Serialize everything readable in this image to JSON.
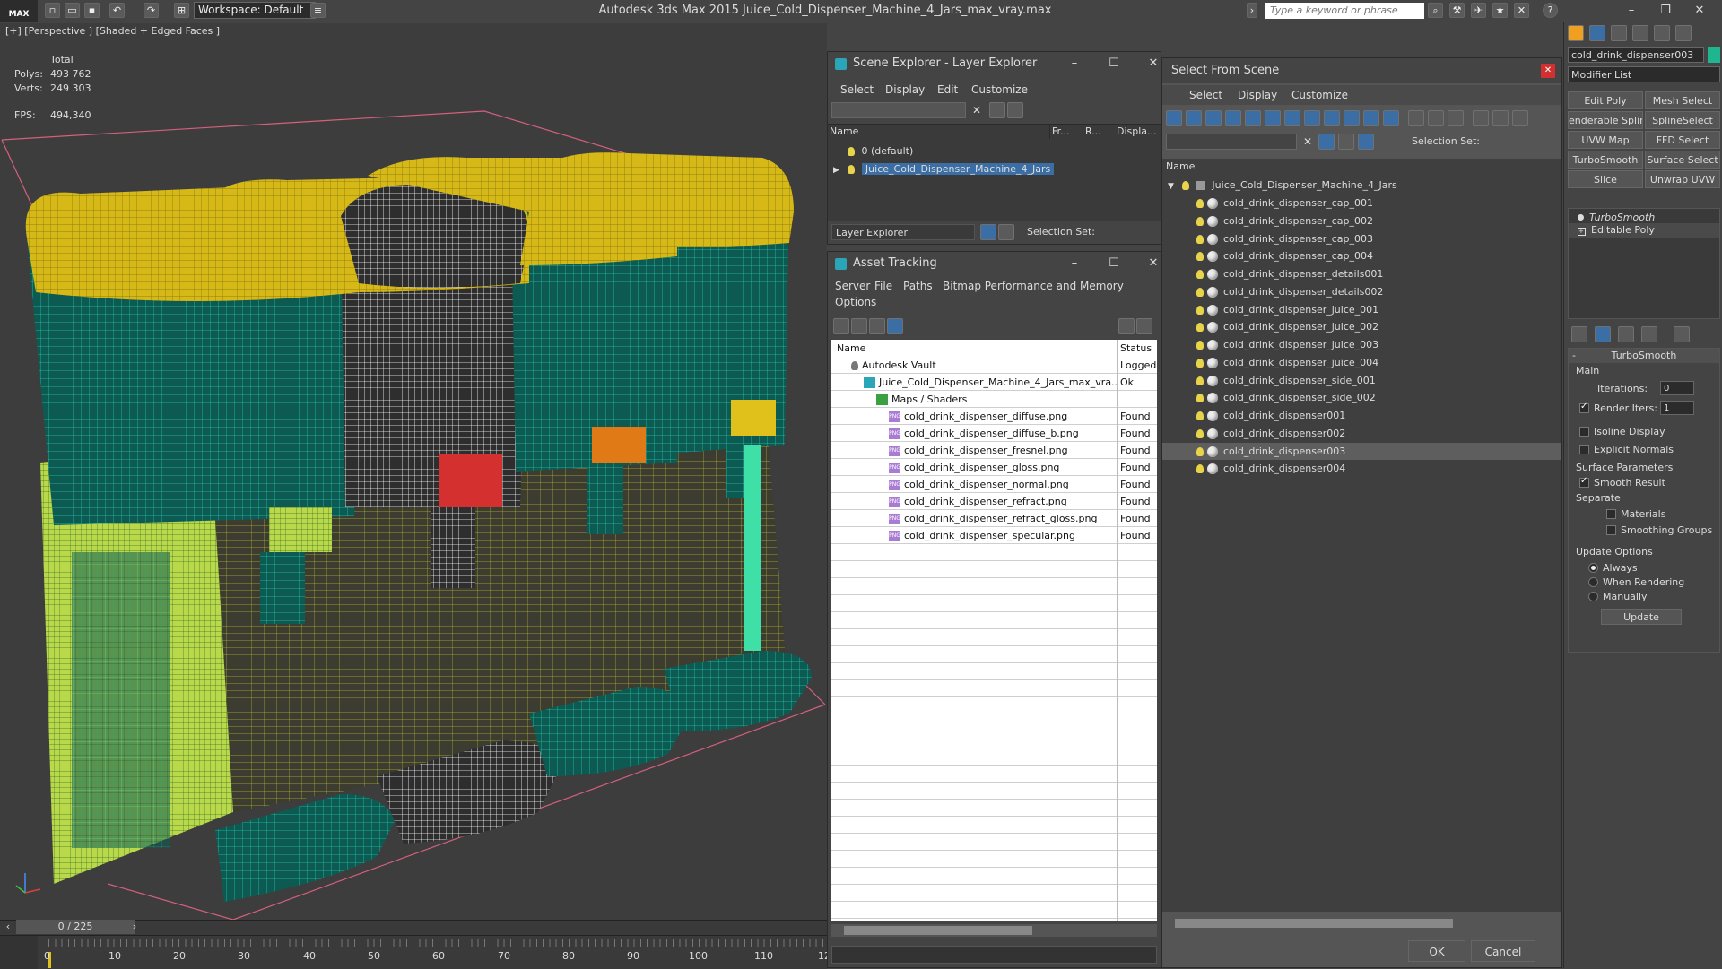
{
  "app": {
    "logo": "MAX",
    "workspace": "Workspace: Default",
    "window_title": "Autodesk 3ds Max  2015     Juice_Cold_Dispenser_Machine_4_Jars_max_vray.max",
    "search_placeholder": "Type a keyword or phrase",
    "controls": {
      "minimize": "–",
      "restore": "❐",
      "close": "✕"
    }
  },
  "viewport": {
    "label": "[+] [Perspective ] [Shaded + Edged Faces ]",
    "stats": {
      "total_label": "Total",
      "polys_label": "Polys:",
      "polys_value": "493 762",
      "verts_label": "Verts:",
      "verts_value": "249 303",
      "fps_label": "FPS:",
      "fps_value": "494,340"
    },
    "axis": {
      "x": "x",
      "y": "y",
      "z": "z"
    }
  },
  "timeline": {
    "frame_indicator": "0 / 225",
    "ticks": [
      "0",
      "10",
      "20",
      "30",
      "40",
      "50",
      "60",
      "70",
      "80",
      "90",
      "100",
      "110",
      "12"
    ]
  },
  "scene_explorer": {
    "title": "Scene Explorer - Layer Explorer",
    "menu": [
      "Select",
      "Display",
      "Edit",
      "Customize"
    ],
    "columns": {
      "name": "Name",
      "frozen": "Fr...",
      "render": "R...",
      "display": "Displa..."
    },
    "rows": [
      {
        "name": "0 (default)"
      },
      {
        "name": "Juice_Cold_Dispenser_Machine_4_Jars"
      }
    ],
    "footer_dropdown": "Layer Explorer",
    "selection_set_label": "Selection Set:"
  },
  "asset_tracking": {
    "title": "Asset Tracking",
    "menu": [
      "Server",
      "File",
      "Paths",
      "Bitmap Performance and Memory",
      "Options"
    ],
    "columns": {
      "name": "Name",
      "status": "Status"
    },
    "rows": [
      {
        "name": "Autodesk Vault",
        "status": "Logged",
        "indent": 0
      },
      {
        "name": "Juice_Cold_Dispenser_Machine_4_Jars_max_vra...",
        "status": "Ok",
        "indent": 1
      },
      {
        "name": "Maps / Shaders",
        "status": "",
        "indent": 2
      },
      {
        "name": "cold_drink_dispenser_diffuse.png",
        "status": "Found",
        "indent": 3
      },
      {
        "name": "cold_drink_dispenser_diffuse_b.png",
        "status": "Found",
        "indent": 3
      },
      {
        "name": "cold_drink_dispenser_fresnel.png",
        "status": "Found",
        "indent": 3
      },
      {
        "name": "cold_drink_dispenser_gloss.png",
        "status": "Found",
        "indent": 3
      },
      {
        "name": "cold_drink_dispenser_normal.png",
        "status": "Found",
        "indent": 3
      },
      {
        "name": "cold_drink_dispenser_refract.png",
        "status": "Found",
        "indent": 3
      },
      {
        "name": "cold_drink_dispenser_refract_gloss.png",
        "status": "Found",
        "indent": 3
      },
      {
        "name": "cold_drink_dispenser_specular.png",
        "status": "Found",
        "indent": 3
      }
    ]
  },
  "select_from_scene": {
    "title": "Select From Scene",
    "menu": [
      "Select",
      "Display",
      "Customize"
    ],
    "selection_set_label": "Selection Set:",
    "column_name": "Name",
    "root": "Juice_Cold_Dispenser_Machine_4_Jars",
    "items": [
      "cold_drink_dispenser_cap_001",
      "cold_drink_dispenser_cap_002",
      "cold_drink_dispenser_cap_003",
      "cold_drink_dispenser_cap_004",
      "cold_drink_dispenser_details001",
      "cold_drink_dispenser_details002",
      "cold_drink_dispenser_juice_001",
      "cold_drink_dispenser_juice_002",
      "cold_drink_dispenser_juice_003",
      "cold_drink_dispenser_juice_004",
      "cold_drink_dispenser_side_001",
      "cold_drink_dispenser_side_002",
      "cold_drink_dispenser001",
      "cold_drink_dispenser002",
      "cold_drink_dispenser003",
      "cold_drink_dispenser004"
    ],
    "selected_index": 14,
    "ok_label": "OK",
    "cancel_label": "Cancel"
  },
  "command_panel": {
    "object_name": "cold_drink_dispenser003",
    "modifier_list": "Modifier List",
    "buttons": [
      "Edit Poly",
      "Mesh Select",
      "enderable Splir",
      "SplineSelect",
      "UVW Map",
      "FFD Select",
      "TurboSmooth",
      "Surface Select",
      "Slice",
      "Unwrap UVW"
    ],
    "stack": [
      "TurboSmooth",
      "Editable Poly"
    ],
    "rollout_title": "TurboSmooth",
    "main_label": "Main",
    "iterations_label": "Iterations:",
    "iterations_value": "0",
    "render_iters_label": "Render Iters:",
    "render_iters_value": "1",
    "isoline_label": "Isoline Display",
    "explicit_normals_label": "Explicit Normals",
    "surface_params_label": "Surface Parameters",
    "smooth_result_label": "Smooth Result",
    "separate_label": "Separate",
    "materials_label": "Materials",
    "smoothing_groups_label": "Smoothing Groups",
    "update_options_label": "Update Options",
    "always_label": "Always",
    "when_rendering_label": "When Rendering",
    "manually_label": "Manually",
    "update_button": "Update"
  },
  "colors": {
    "teal": "#1fa08c",
    "yellow": "#e7c41a",
    "lime": "#b9d94a",
    "pink_frame": "#d4607e",
    "selected_row": "#3a6ea5"
  }
}
